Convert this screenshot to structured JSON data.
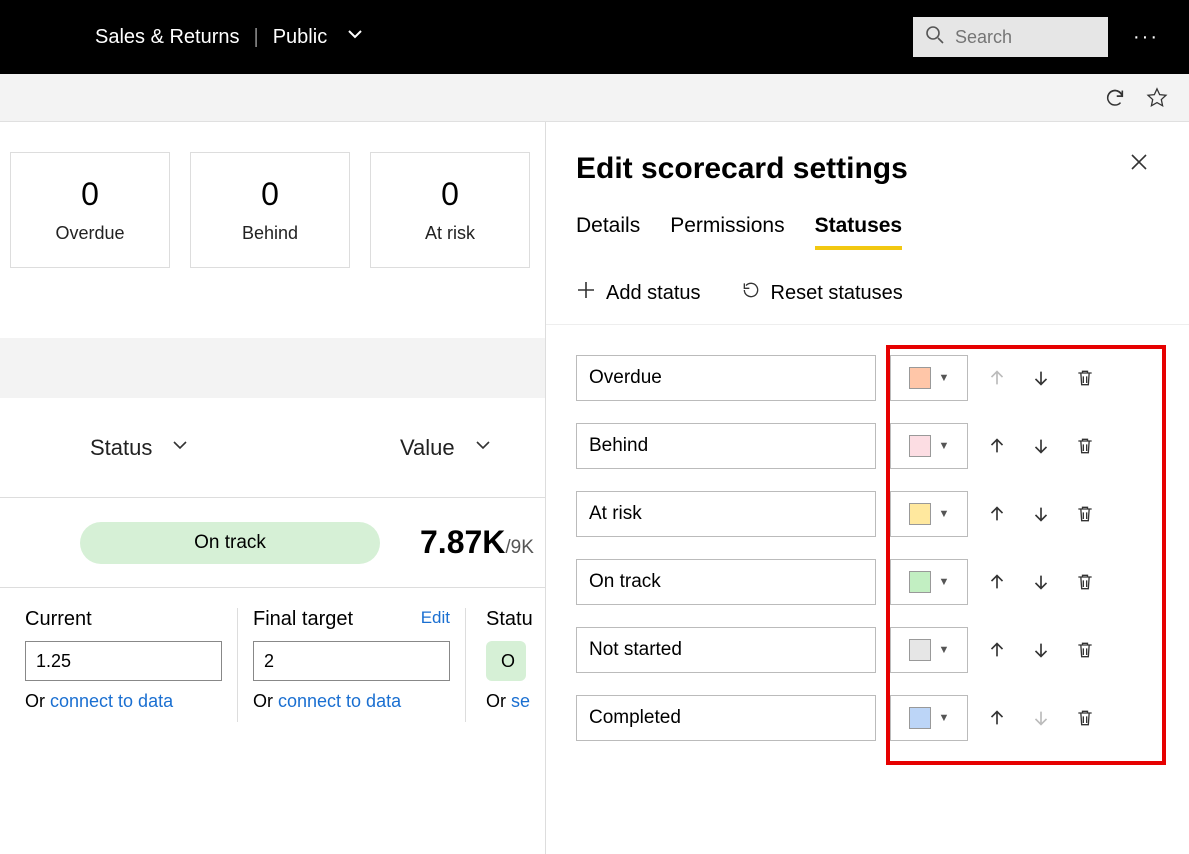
{
  "topbar": {
    "workspace": "Sales & Returns",
    "visibility": "Public",
    "search_placeholder": "Search"
  },
  "cards": [
    {
      "count": "0",
      "label": "Overdue"
    },
    {
      "count": "0",
      "label": "Behind"
    },
    {
      "count": "0",
      "label": "At risk"
    }
  ],
  "columns": {
    "status": "Status",
    "value": "Value"
  },
  "row": {
    "status_text": "On track",
    "value_main": "7.87K",
    "value_sub": "/9K"
  },
  "fields": {
    "current_label": "Current",
    "current_value": "1.25",
    "final_label": "Final target",
    "final_value": "2",
    "edit": "Edit",
    "or": "Or ",
    "connect": "connect to data",
    "status_label": "Statu",
    "status_pill": "O",
    "set_rules_prefix": "Or ",
    "set_rules": "se"
  },
  "panel": {
    "title": "Edit scorecard settings",
    "tabs": {
      "details": "Details",
      "permissions": "Permissions",
      "statuses": "Statuses"
    },
    "add_status": "Add status",
    "reset": "Reset statuses",
    "statuses": [
      {
        "name": "Overdue",
        "color": "#ffc6a8",
        "up_disabled": true,
        "down_disabled": false
      },
      {
        "name": "Behind",
        "color": "#fcdde3",
        "up_disabled": false,
        "down_disabled": false
      },
      {
        "name": "At risk",
        "color": "#ffe89e",
        "up_disabled": false,
        "down_disabled": false
      },
      {
        "name": "On track",
        "color": "#c2efc2",
        "up_disabled": false,
        "down_disabled": false
      },
      {
        "name": "Not started",
        "color": "#e6e6e6",
        "up_disabled": false,
        "down_disabled": false
      },
      {
        "name": "Completed",
        "color": "#bcd5f7",
        "up_disabled": false,
        "down_disabled": true
      }
    ]
  }
}
